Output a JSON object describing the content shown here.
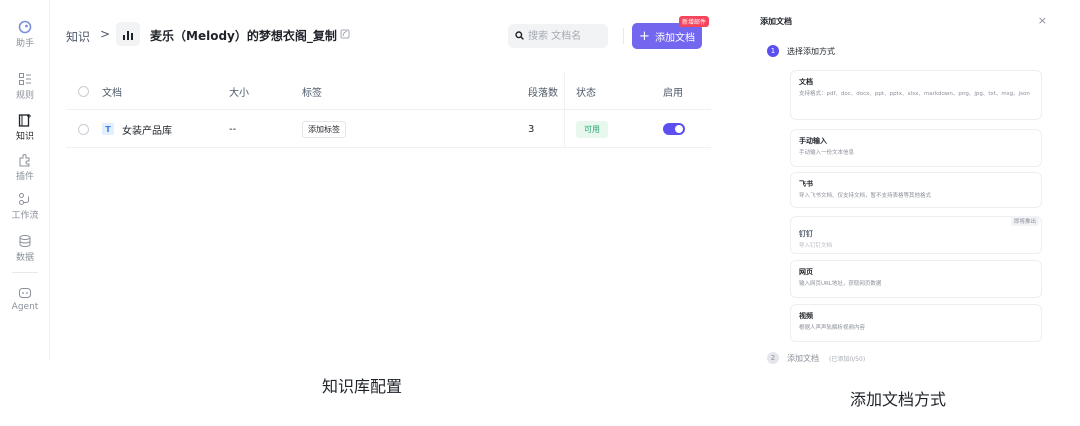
{
  "rail": {
    "items": [
      {
        "label": "助手",
        "icon": "assistant-icon"
      },
      {
        "label": "规则",
        "icon": "rules-icon"
      },
      {
        "label": "知识",
        "icon": "knowledge-icon",
        "active": true
      },
      {
        "label": "插件",
        "icon": "plugin-icon"
      },
      {
        "label": "工作流",
        "icon": "workflow-icon"
      },
      {
        "label": "数据",
        "icon": "database-icon"
      },
      {
        "label": "Agent",
        "icon": "agent-icon"
      }
    ]
  },
  "header": {
    "breadcrumb_root": "知识",
    "breadcrumb_sep": ">",
    "kb_title": "麦乐（Melody）的梦想衣阁_复制",
    "search_placeholder": "搜索 文档名",
    "add_button_label": "添加文档",
    "new_badge": "新增邮件"
  },
  "table": {
    "columns": [
      "文档",
      "大小",
      "标签",
      "段落数",
      "状态",
      "启用"
    ],
    "rows": [
      {
        "name": "女装产品库",
        "size": "--",
        "tag_action": "添加标签",
        "paragraphs": "3",
        "status": "可用",
        "enabled": true
      }
    ]
  },
  "captions": {
    "left": "知识库配置",
    "right": "添加文档方式"
  },
  "panel": {
    "title": "添加文档",
    "close": "×",
    "step1": {
      "num": "1",
      "label": "选择添加方式"
    },
    "options": [
      {
        "title": "文档",
        "desc": "支持格式：pdf、doc、docx、ppt、pptx、xlsx、markdown、png、jpg、txt、msg、json"
      },
      {
        "title": "手动输入",
        "desc": "手动输入一份文本信息"
      },
      {
        "title": "飞书",
        "desc": "导入飞书文档、仅支持文档，暂不支持表格等其他格式"
      },
      {
        "title": "钉钉",
        "desc": "导入钉钉文档",
        "badge": "即将推出",
        "disabled": true
      },
      {
        "title": "网页",
        "desc": "输入网页URL地址，获取网页数据"
      },
      {
        "title": "视频",
        "desc": "根据人声声轨解析视频内容"
      }
    ],
    "step2": {
      "num": "2",
      "label": "添加文档",
      "note": "(已添加0/50)"
    }
  },
  "colors": {
    "accent": "#5b4ff0",
    "button": "#7367f0",
    "badge": "#f5455c",
    "status_ok": "#2ba471"
  }
}
